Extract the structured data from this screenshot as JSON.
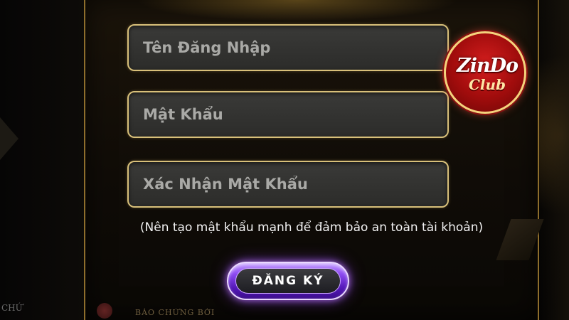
{
  "form": {
    "username": {
      "placeholder": "Tên Đăng Nhập",
      "value": ""
    },
    "password": {
      "placeholder": "Mật Khẩu",
      "value": ""
    },
    "confirm_password": {
      "placeholder": "Xác Nhận Mật Khẩu",
      "value": ""
    },
    "hint": "(Nên tạo mật khẩu mạnh để đảm bảo an toàn tài khoản)",
    "register_label": "ĐĂNG KÝ"
  },
  "logo": {
    "line1": "ZinDo",
    "line2": "Club"
  },
  "footer": {
    "left_text": "CHỨ",
    "center_text": "BẢO CHỨNG BỞI"
  },
  "colors": {
    "field_border": "#d8c07a",
    "field_bg": "#333331",
    "button_accent": "#8e4bf2",
    "logo_red": "#c41414",
    "panel_gold": "#8e6e2c"
  }
}
